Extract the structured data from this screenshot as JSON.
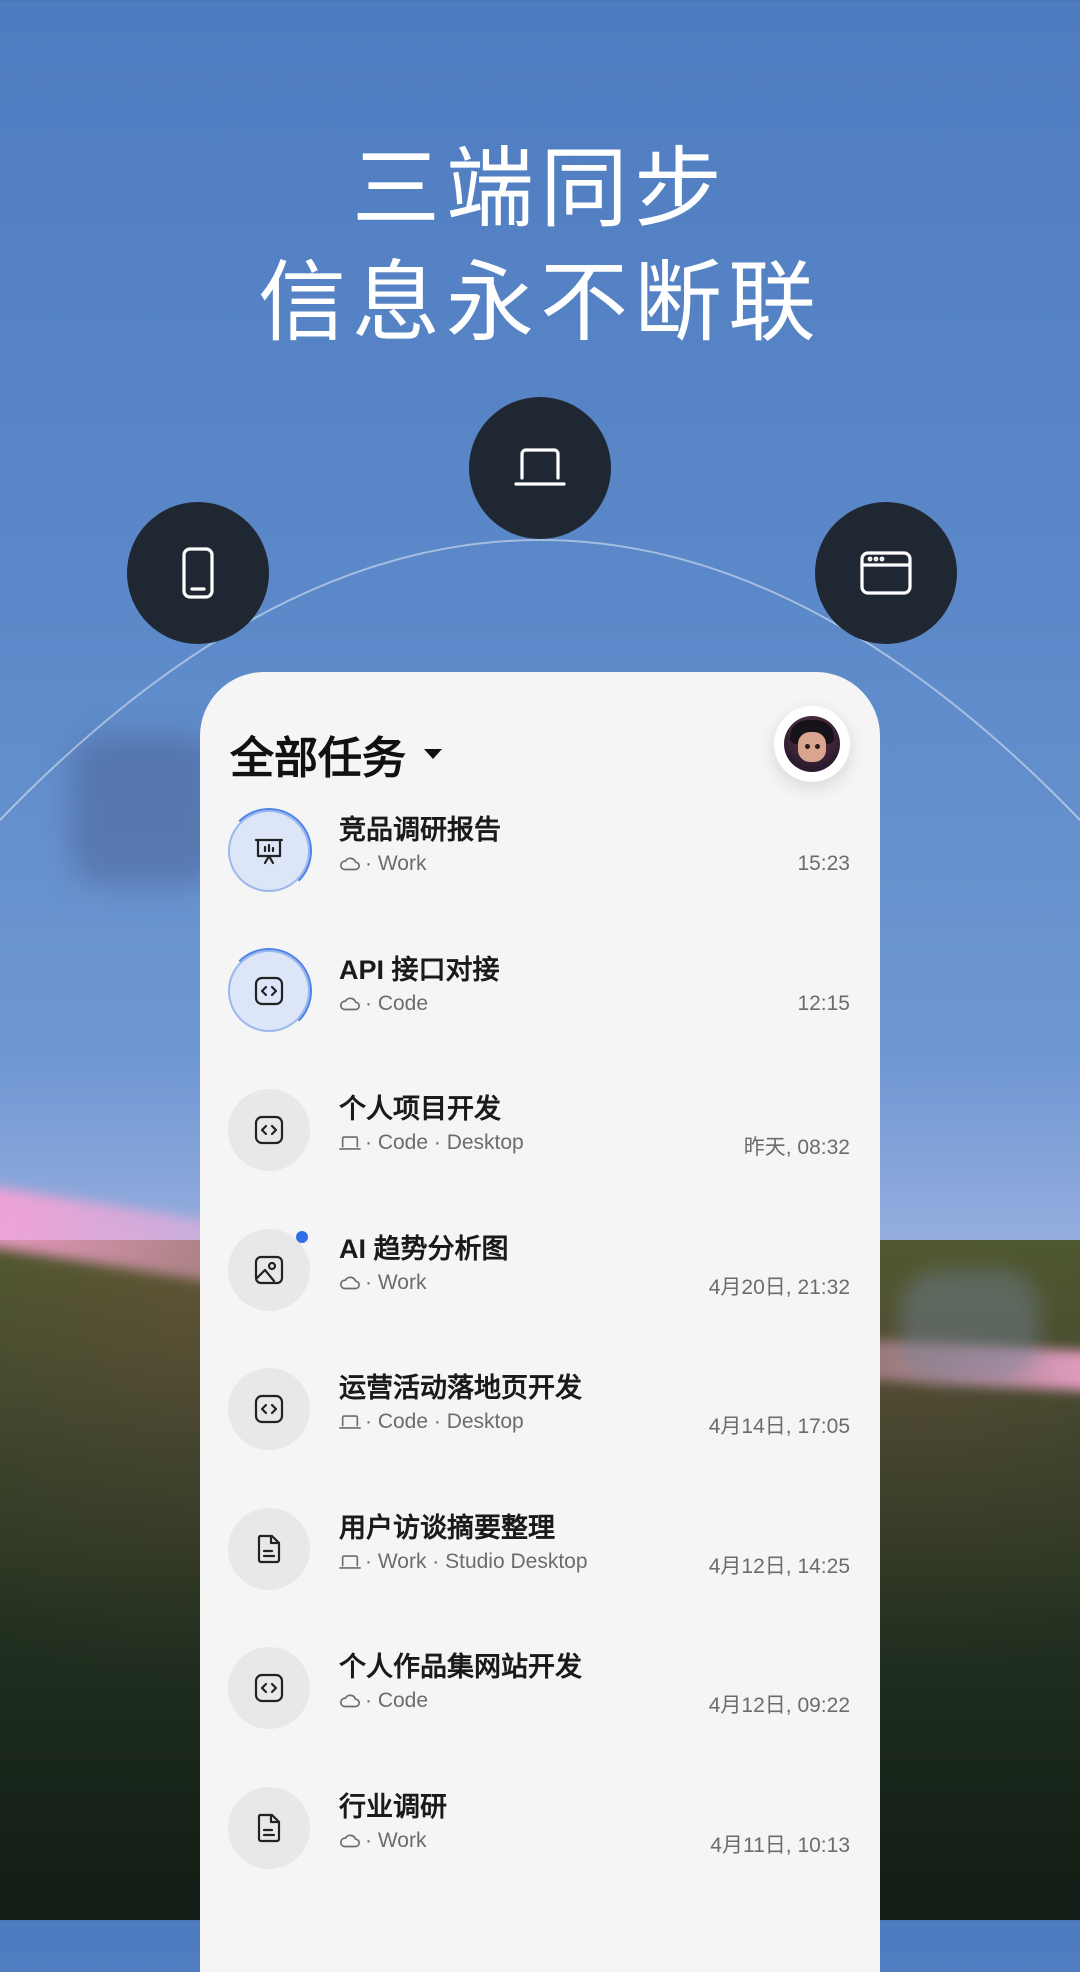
{
  "headline": {
    "line1": "三端同步",
    "line2": "信息永不断联"
  },
  "devices": [
    {
      "icon": "phone-icon"
    },
    {
      "icon": "laptop-icon"
    },
    {
      "icon": "browser-window-icon"
    }
  ],
  "card": {
    "title": "全部任务",
    "avatar": "user-avatar"
  },
  "tasks": [
    {
      "title": "竞品调研报告",
      "source_icon": "cloud-icon",
      "meta": "· Work",
      "time": "15:23",
      "icon": "presentation-chart-icon",
      "active": true,
      "unread": false
    },
    {
      "title": "API 接口对接",
      "source_icon": "cloud-icon",
      "meta": "· Code",
      "time": "12:15",
      "icon": "code-icon",
      "active": true,
      "unread": false
    },
    {
      "title": "个人项目开发",
      "source_icon": "laptop-icon",
      "meta": "· Code · Desktop",
      "time": "昨天, 08:32",
      "icon": "code-icon",
      "active": false,
      "unread": false
    },
    {
      "title": "AI 趋势分析图",
      "source_icon": "cloud-icon",
      "meta": "· Work",
      "time": "4月20日, 21:32",
      "icon": "image-icon",
      "active": false,
      "unread": true
    },
    {
      "title": "运营活动落地页开发",
      "source_icon": "laptop-icon",
      "meta": "· Code · Desktop",
      "time": "4月14日, 17:05",
      "icon": "code-icon",
      "active": false,
      "unread": false
    },
    {
      "title": "用户访谈摘要整理",
      "source_icon": "laptop-icon",
      "meta": "· Work · Studio Desktop",
      "time": "4月12日, 14:25",
      "icon": "document-icon",
      "active": false,
      "unread": false
    },
    {
      "title": "个人作品集网站开发",
      "source_icon": "cloud-icon",
      "meta": "· Code",
      "time": "4月12日, 09:22",
      "icon": "code-icon",
      "active": false,
      "unread": false
    },
    {
      "title": "行业调研",
      "source_icon": "cloud-icon",
      "meta": "· Work",
      "time": "4月11日, 10:13",
      "icon": "document-icon",
      "active": false,
      "unread": false
    }
  ],
  "colors": {
    "accent": "#2f6fea",
    "device_bg": "#1f2832",
    "card_bg": "#f5f5f6"
  }
}
